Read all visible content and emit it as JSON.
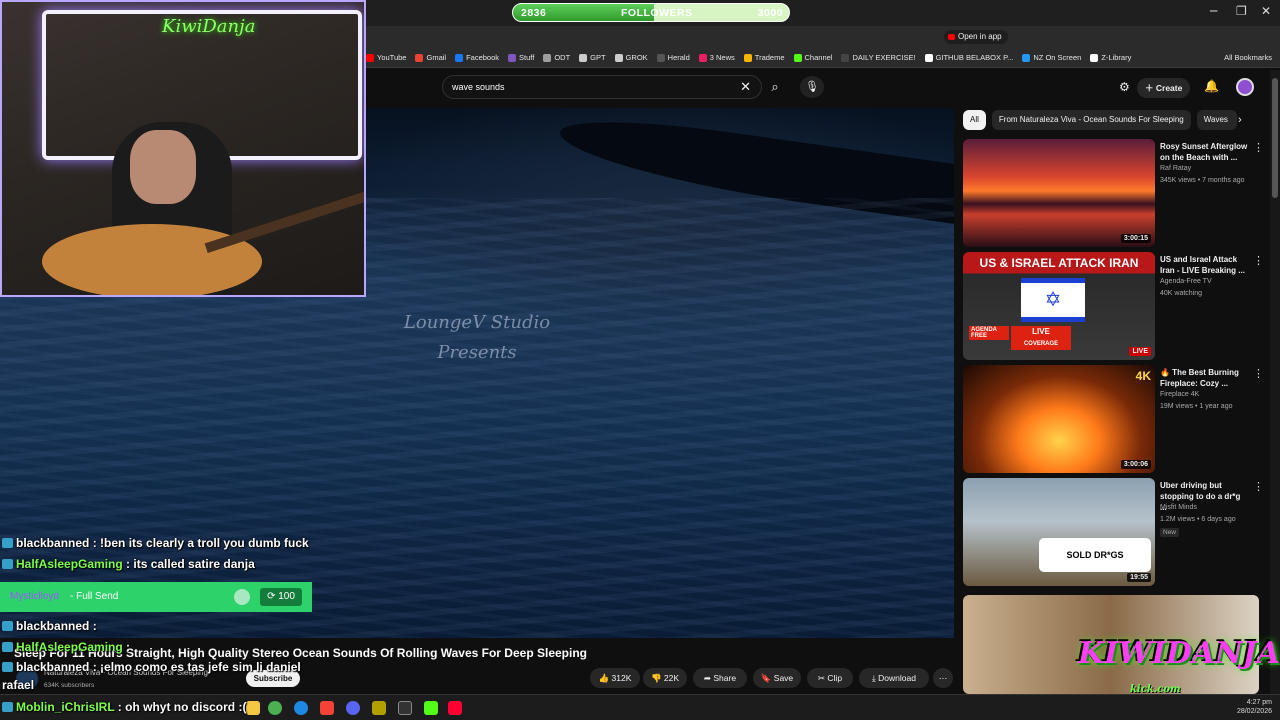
{
  "followers_goal": {
    "current": "2836",
    "label": "FOLLOWERS",
    "target": "3000",
    "progress": 0.51
  },
  "browser": {
    "open_in_app": "Open in app",
    "bookmarks": [
      {
        "label": "YouTube",
        "color": "#ff0000"
      },
      {
        "label": "Gmail",
        "color": "#ea4335"
      },
      {
        "label": "Facebook",
        "color": "#1877f2"
      },
      {
        "label": "Stuff",
        "color": "#7e57c2"
      },
      {
        "label": "ODT",
        "color": "#9e9e9e"
      },
      {
        "label": "GPT",
        "color": "#cccccc"
      },
      {
        "label": "GROK",
        "color": "#cccccc"
      },
      {
        "label": "Herald",
        "color": "#555555"
      },
      {
        "label": "3 News",
        "color": "#e91e63"
      },
      {
        "label": "Trademe",
        "color": "#f7b500"
      },
      {
        "label": "Channel",
        "color": "#53fc18"
      },
      {
        "label": "DAILY EXERCISE!",
        "color": "#444444"
      },
      {
        "label": "GITHUB BELABOX P...",
        "color": "#ffffff"
      },
      {
        "label": "NZ On Screen",
        "color": "#2196f3"
      },
      {
        "label": "Z-Library",
        "color": "#ffffff"
      }
    ],
    "all_bookmarks": "All Bookmarks"
  },
  "youtube": {
    "search_query": "wave sounds",
    "create_label": "Create",
    "video": {
      "watermark_line1": "LoungeV Studio",
      "watermark_line2": "Presents",
      "title": "Sleep For 11 Hours Straight, High Quality Stereo Ocean Sounds Of Rolling Waves For Deep Sleeping",
      "channel": "Naturaleza Viva - Ocean Sounds For Sleeping",
      "subscribers": "634K subscribers",
      "subscribe_label": "Subscribe",
      "likes": "312K",
      "dislikes": "22K",
      "share_label": "Share",
      "save_label": "Save",
      "clip_label": "Clip",
      "download_label": "Download"
    },
    "chips": [
      "All",
      "From Naturaleza Viva - Ocean Sounds For Sleeping",
      "Waves"
    ],
    "recommendations": [
      {
        "title": "Rosy Sunset Afterglow on the Beach with ...",
        "channel": "Raf Ratay",
        "meta": "345K views • 7 months ago",
        "duration": "3:00:15",
        "badge": ""
      },
      {
        "title": "US and Israel Attack Iran - LIVE Breaking ...",
        "channel": "Agenda-Free TV",
        "meta": "40K watching",
        "duration": "LIVE",
        "badge": "",
        "thumb_text": "US & ISRAEL ATTACK IRAN",
        "thumb_live": "LIVE",
        "thumb_coverage": "COVERAGE",
        "thumb_source": "AGENDA FREE"
      },
      {
        "title": "🔥 The Best Burning Fireplace: Cozy ...",
        "channel": "Fireplace 4K",
        "meta": "19M views • 1 year ago",
        "duration": "3:00:06",
        "badge": "4K"
      },
      {
        "title": "Uber driving but stopping to do a dr*g ...",
        "channel": "Misfit Minds",
        "meta": "1.2M views • 6 days ago",
        "duration": "19:55",
        "badge": "New",
        "thumb_text": "SOLD DR*GS"
      }
    ]
  },
  "chat": [
    {
      "user": "blackbanned",
      "message": " : !ben its clearly a troll you dumb fuck",
      "color": "#ffffff"
    },
    {
      "user": "HalfAsleepGaming",
      "message": " : its called satire danja",
      "color": "#7dff4a"
    },
    {
      "user": "blackbanned",
      "message": " : ",
      "color": "#ffffff"
    },
    {
      "user": "HalfAsleepGaming",
      "message": " : ",
      "color": "#7dff4a"
    },
    {
      "user": "blackbanned",
      "message": " : ¡elmo como es tas jefe sim li daniel",
      "color": "#ffffff"
    },
    {
      "user": "rafael",
      "message": "",
      "color": "#ffffff"
    },
    {
      "user": "Moblin_iChrisIRL",
      "message": " : oh whyt no discord :(",
      "color": "#7dff4a"
    }
  ],
  "redeem": {
    "user": "Mysticlloyd",
    "reward": "- Full Send",
    "cost": "100"
  },
  "overlay": {
    "brand": "KIWIDANJA",
    "url": "kick.com"
  },
  "webcam": {
    "neon_sign": "KiwiDanja"
  },
  "taskbar": {
    "time": "4:27 pm",
    "date": "28/02/2026"
  }
}
